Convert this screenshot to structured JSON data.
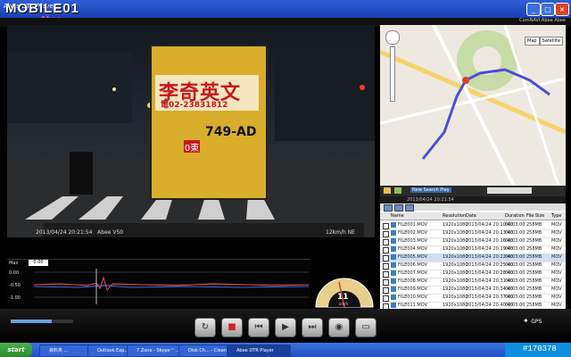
{
  "window": {
    "title": "Abee DTR Player",
    "watermark": "MOBILE01",
    "watermark_sub": "Abee",
    "header_right": "ComNAVI Abee Abee"
  },
  "video": {
    "bus_sign": "李奇英文",
    "bus_phone": "電02-23831812",
    "bus_plate": "749-AD",
    "bus_route": "0東",
    "timestamp": "2013/04/24 20:21:54",
    "model": "Abee V50",
    "speed": "12km/h NE"
  },
  "map": {
    "map_btn": "Map",
    "satellite_btn": "Satellite",
    "tool_label": "New Search Play",
    "date_label": "2013/04/24 20:21:54"
  },
  "file_table": {
    "headers": [
      "Name",
      "Resolution",
      "Date",
      "Duration",
      "File Size",
      "Type"
    ],
    "rows": [
      {
        "name": "FILE001.MOV",
        "res": "1920x1080",
        "date": "2013/04/24 20:10:40",
        "dur": "00:03:00",
        "size": "258MB",
        "type": "MOV"
      },
      {
        "name": "FILE002.MOV",
        "res": "1920x1080",
        "date": "2013/04/24 20:13:40",
        "dur": "00:03:00",
        "size": "258MB",
        "type": "MOV"
      },
      {
        "name": "FILE003.MOV",
        "res": "1920x1080",
        "date": "2013/04/24 20:16:40",
        "dur": "00:03:00",
        "size": "258MB",
        "type": "MOV"
      },
      {
        "name": "FILE004.MOV",
        "res": "1920x1080",
        "date": "2013/04/24 20:19:40",
        "dur": "00:03:00",
        "size": "258MB",
        "type": "MOV"
      },
      {
        "name": "FILE005.MOV",
        "res": "1920x1080",
        "date": "2013/04/24 20:22:40",
        "dur": "00:03:00",
        "size": "258MB",
        "type": "MOV"
      },
      {
        "name": "FILE006.MOV",
        "res": "1920x1080",
        "date": "2013/04/24 20:25:40",
        "dur": "00:03:00",
        "size": "258MB",
        "type": "MOV"
      },
      {
        "name": "FILE007.MOV",
        "res": "1920x1080",
        "date": "2013/04/24 20:28:40",
        "dur": "00:03:00",
        "size": "258MB",
        "type": "MOV"
      },
      {
        "name": "FILE008.MOV",
        "res": "1920x1080",
        "date": "2013/04/24 20:31:40",
        "dur": "00:03:00",
        "size": "258MB",
        "type": "MOV"
      },
      {
        "name": "FILE009.MOV",
        "res": "1920x1080",
        "date": "2013/04/24 20:34:40",
        "dur": "00:03:00",
        "size": "258MB",
        "type": "MOV"
      },
      {
        "name": "FILE010.MOV",
        "res": "1920x1080",
        "date": "2013/04/24 20:37:40",
        "dur": "00:03:00",
        "size": "258MB",
        "type": "MOV"
      },
      {
        "name": "FILE011.MOV",
        "res": "1920x1080",
        "date": "2013/04/24 20:40:40",
        "dur": "00:03:00",
        "size": "258MB",
        "type": "MOV"
      },
      {
        "name": "FILE012.MOV",
        "res": "1920x1080",
        "date": "2013/04/24 20:43:40",
        "dur": "00:03:00",
        "size": "258MB",
        "type": "MOV"
      }
    ]
  },
  "graph": {
    "label": "Max",
    "value": "0.00",
    "y_top": "0.00",
    "y_mid": "-0.50",
    "y_bot": "-1.00"
  },
  "gauge": {
    "speed": "11",
    "unit": "km/h"
  },
  "controls": {
    "tools_label": "GPS"
  },
  "taskbar": {
    "start": "start",
    "tasks": [
      "資料夾 ...",
      "Outlook Exp...",
      "7 Zone - Skype™ ...",
      "Disk Ch... - Clean...",
      "Abee DTR Player"
    ],
    "tag": "#170378"
  }
}
